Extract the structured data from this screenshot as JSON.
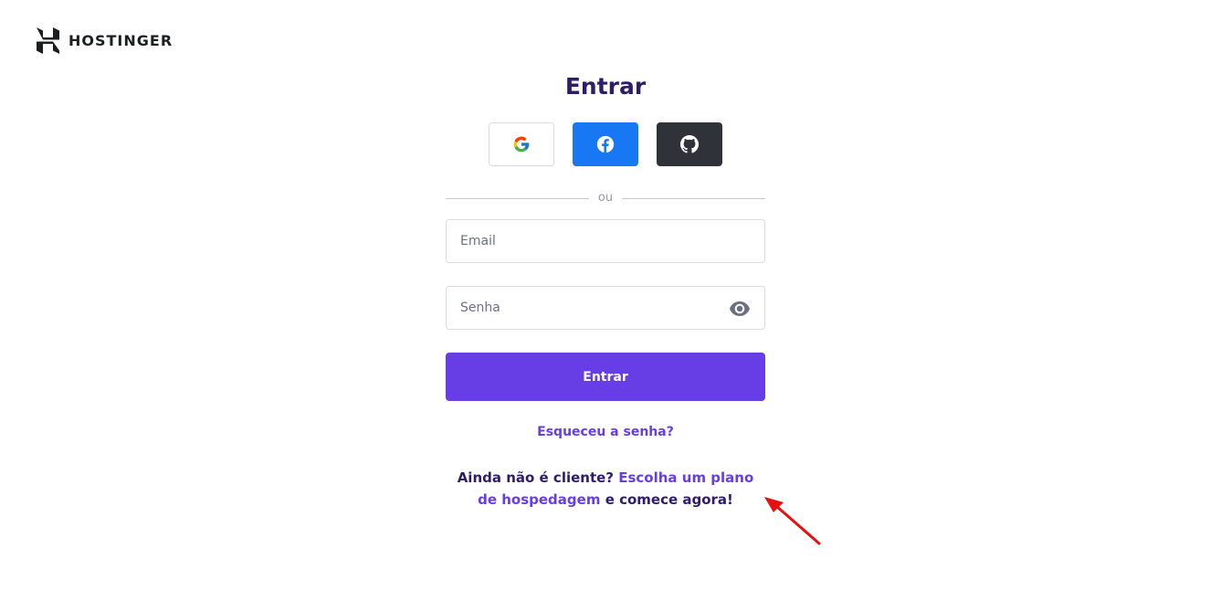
{
  "brand": {
    "name": "HOSTINGER",
    "logo_icon": "hostinger-logo-icon"
  },
  "login": {
    "title": "Entrar",
    "social": [
      {
        "name": "google",
        "icon": "google-icon"
      },
      {
        "name": "facebook",
        "icon": "facebook-icon",
        "color": "#1877f2"
      },
      {
        "name": "github",
        "icon": "github-icon",
        "color": "#2f3238"
      }
    ],
    "divider_text": "ou",
    "email": {
      "placeholder": "Email",
      "value": ""
    },
    "password": {
      "placeholder": "Senha",
      "value": "",
      "toggle_icon": "eye-icon"
    },
    "submit_label": "Entrar",
    "forgot_label": "Esqueceu a senha?",
    "signup": {
      "prefix": "Ainda não é cliente?",
      "link": "Escolha um plano de hospedagem",
      "suffix": "e comece agora!"
    }
  },
  "colors": {
    "accent": "#673de6",
    "heading": "#2f1c6a",
    "annotation_arrow": "#e8100e"
  }
}
